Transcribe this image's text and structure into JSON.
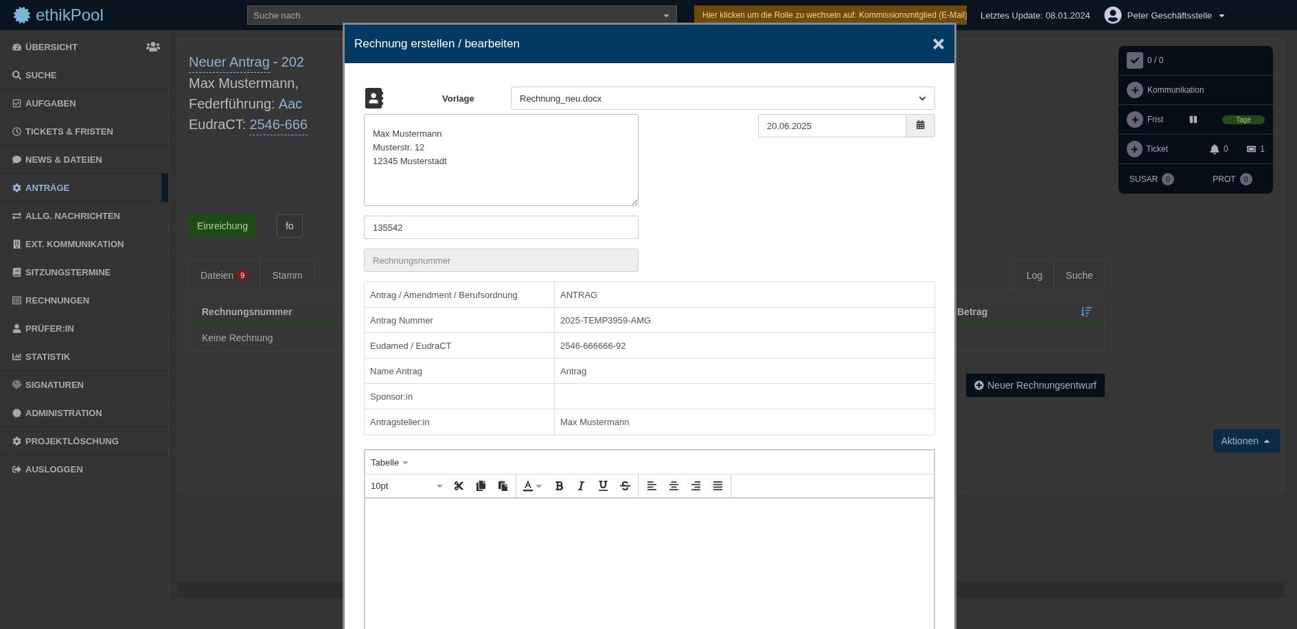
{
  "header": {
    "brand": "ethikPool",
    "search": {
      "placeholder": "Suche nach"
    },
    "role_banner": "Hier klicken um die Rolle zu wechseln auf: Kommissionsmitglied (E-Mail)",
    "last_update": "Letztes Update: 08.01.2024",
    "user": "Peter Geschäftsstelle"
  },
  "sidebar": {
    "items": [
      {
        "label": "ÜBERSICHT",
        "selected": false
      },
      {
        "label": "SUCHE",
        "selected": false
      },
      {
        "label": "AUFGABEN",
        "selected": false
      },
      {
        "label": "TICKETS & FRISTEN",
        "selected": false
      },
      {
        "label": "NEWS & DATEIEN",
        "selected": false
      },
      {
        "label": "ANTRÄGE",
        "selected": true
      },
      {
        "label": "ALLG. NACHRICHTEN",
        "selected": false
      },
      {
        "label": "EXT. KOMMUNIKATION",
        "selected": false
      },
      {
        "label": "SITZUNGSTERMINE",
        "selected": false
      },
      {
        "label": "RECHNUNGEN",
        "selected": false
      },
      {
        "label": "PRÜFER:IN",
        "selected": false
      },
      {
        "label": "STATISTIK",
        "selected": false
      },
      {
        "label": "SIGNATUREN",
        "selected": false
      },
      {
        "label": "ADMINISTRATION",
        "selected": false
      },
      {
        "label": "PROJEKTLÖSCHUNG",
        "selected": false
      },
      {
        "label": "AUSLOGGEN",
        "selected": false
      }
    ]
  },
  "project": {
    "title_link": "Neuer Antrag",
    "title_sep": "-",
    "title_id": "202",
    "applicant": "Max Mustermann,",
    "lead_label": "Federführung:",
    "lead_value": "Aac",
    "eudract_label": "EudraCT:",
    "eudract_value": "2546-666"
  },
  "actions": {
    "submit": "Einreichung",
    "second": "fo"
  },
  "tabs": [
    {
      "label": "Dateien",
      "badge": "9"
    },
    {
      "label": "Stamm"
    },
    {
      "label": "Log"
    },
    {
      "label": "Suche"
    }
  ],
  "invoice_table": {
    "columns": [
      "Rechnungsnummer",
      "Betrag"
    ],
    "empty": "Keine Rechnung"
  },
  "new_draft_button": "Neuer Rechnungsentwurf",
  "actions_button": "Aktionen",
  "status_panel": {
    "tasks": "0 / 0",
    "communication": "Kommunikation",
    "deadline": "Frist",
    "deadline_pill": "Tage",
    "ticket": "Ticket",
    "bell_count": "0",
    "ticket_count": "1",
    "susar": "SUSAR",
    "susar_count": "0",
    "prot": "PROT",
    "prot_count": "0"
  },
  "modal": {
    "title": "Rechnung erstellen / bearbeiten",
    "template_label": "Vorlage",
    "template_value": "Rechnung_neu.docx",
    "address": "Max Mustermann\nMusterstr. 12\n12345 Musterstadt",
    "date": "20.06.2025",
    "number_value": "135542",
    "invoice_number": {
      "placeholder": "Rechnungsnummer",
      "disabled": true
    },
    "details": [
      {
        "label": "Antrag / Amendment / Berufsordnung",
        "value": "ANTRAG"
      },
      {
        "label": "Antrag Nummer",
        "value": "2025-TEMP3959-AMG"
      },
      {
        "label": "Eudamed / EudraCT",
        "value": "2546-666666-92"
      },
      {
        "label": "Name Antrag",
        "value": "Antrag"
      },
      {
        "label": "Sponsor:in"
      },
      {
        "label": "Antragsteller:in",
        "value": "Max Mustermann"
      }
    ],
    "editor": {
      "menu": "Tabelle",
      "font_size": "10pt"
    }
  }
}
